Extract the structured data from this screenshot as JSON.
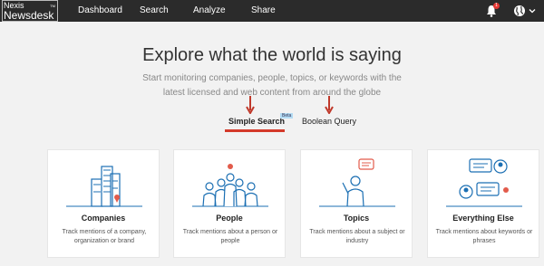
{
  "app": {
    "logo_line1": "Nexis",
    "logo_line2": "Newsdesk",
    "logo_tm": "TM"
  },
  "nav": {
    "items": [
      {
        "label": "Dashboard"
      },
      {
        "label": "Search"
      },
      {
        "label": "Analyze"
      },
      {
        "label": "Share"
      }
    ]
  },
  "notifications": {
    "count": "1"
  },
  "hero": {
    "title": "Explore what the world is saying",
    "subtitle": "Start monitoring companies, people, topics, or keywords with the latest licensed and web content from around the globe"
  },
  "tabs": {
    "simple": "Simple Search",
    "beta": "Beta",
    "boolean": "Boolean Query"
  },
  "cards": [
    {
      "title": "Companies",
      "desc": "Track mentions of a company, organization or brand",
      "icon": "buildings-icon"
    },
    {
      "title": "People",
      "desc": "Track mentions about a person or people",
      "icon": "people-icon"
    },
    {
      "title": "Topics",
      "desc": "Track mentions about a subject or industry",
      "icon": "topic-person-icon"
    },
    {
      "title": "Everything Else",
      "desc": "Track mentions about keywords or phrases",
      "icon": "chat-bubbles-icon"
    }
  ],
  "colors": {
    "accent": "#d43a2a",
    "nav_bg": "#2b2b2b",
    "illustration": "#1b6fb3"
  }
}
